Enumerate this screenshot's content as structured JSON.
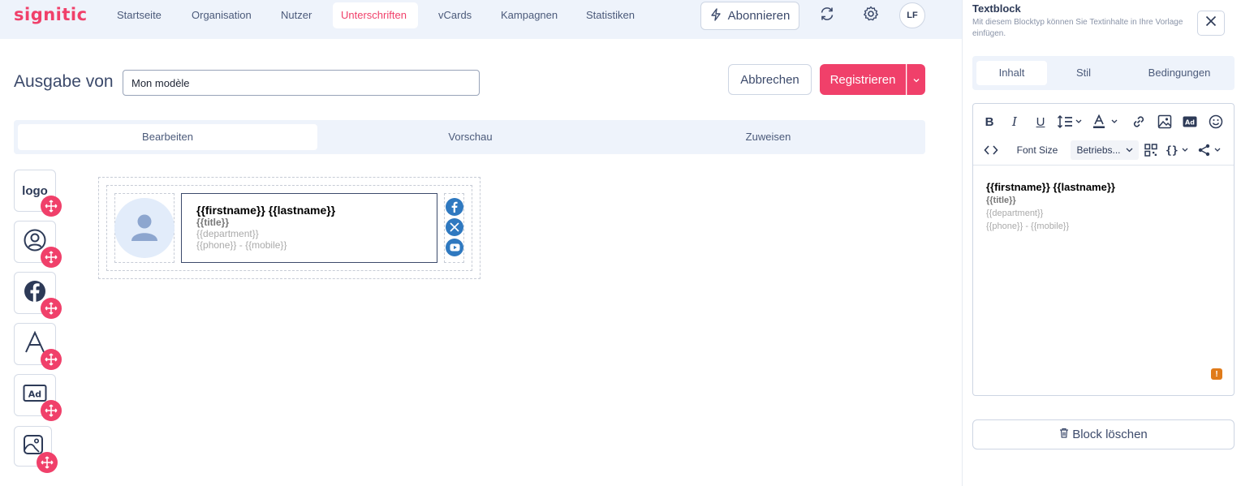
{
  "brand": {
    "logo_text": "signitic",
    "accent": "#f0406a"
  },
  "nav": {
    "items": [
      {
        "label": "Startseite"
      },
      {
        "label": "Organisation"
      },
      {
        "label": "Nutzer"
      },
      {
        "label": "Unterschriften"
      },
      {
        "label": "vCards"
      },
      {
        "label": "Kampagnen"
      },
      {
        "label": "Statistiken"
      }
    ],
    "active": "Unterschriften",
    "subscribe_label": "Abonnieren",
    "user_initials": "LF"
  },
  "editor_header": {
    "title": "Ausgabe von",
    "template_name": "Mon modèle",
    "cancel_label": "Abbrechen",
    "register_label": "Registrieren"
  },
  "tabs": [
    {
      "label": "Bearbeiten"
    },
    {
      "label": "Vorschau"
    },
    {
      "label": "Zuweisen"
    }
  ],
  "tools": {
    "logo_label": "logo",
    "icons": [
      "user-circle-icon",
      "facebook-icon",
      "text-icon",
      "ad-icon",
      "image-icon"
    ]
  },
  "signature": {
    "name_line": "{{firstname}} {{lastname}}",
    "title_line": "{{title}}",
    "department_line": "{{department}}",
    "phone_line": "{{phone}} - {{mobile}}",
    "socials": [
      "facebook-icon",
      "x-icon",
      "youtube-icon"
    ]
  },
  "panel": {
    "title": "Textblock",
    "description": "Mit diesem Blocktyp können Sie Textinhalte in Ihre Vorlage einfügen.",
    "tabs": [
      {
        "label": "Inhalt"
      },
      {
        "label": "Stil"
      },
      {
        "label": "Bedingungen"
      }
    ],
    "toolbar": {
      "font_size_label": "Font Size",
      "font_family_label": "Betriebs..."
    },
    "content": {
      "name_line": "{{firstname}} {{lastname}}",
      "title_line": "{{title}}",
      "department_line": "{{department}}",
      "phone_line": "{{phone}} - {{mobile}}"
    },
    "warning_mark": "!",
    "delete_label": "Block löschen"
  }
}
